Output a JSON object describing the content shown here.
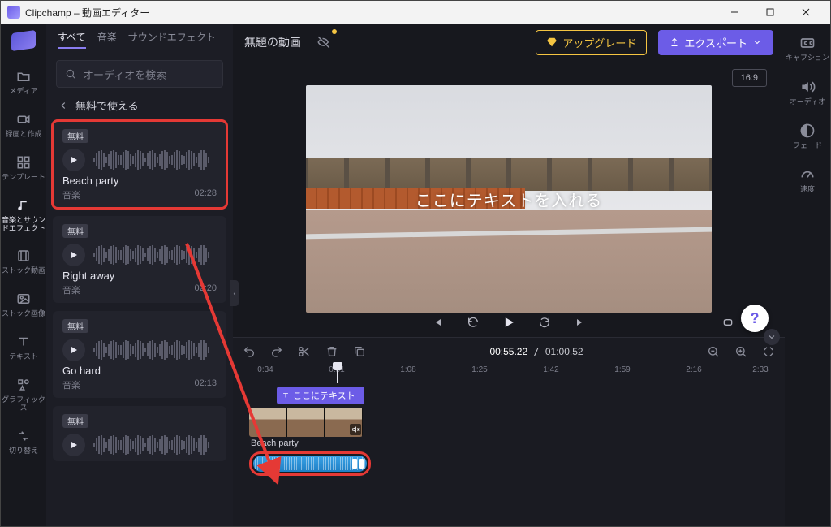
{
  "window": {
    "title": "Clipchamp – 動画エディター"
  },
  "rail": {
    "items": [
      {
        "label": "メディア"
      },
      {
        "label": "録画と作成"
      },
      {
        "label": "テンプレート"
      },
      {
        "label": "音楽とサウンドエフェクト"
      },
      {
        "label": "ストック動画"
      },
      {
        "label": "ストック画像"
      },
      {
        "label": "テキスト"
      },
      {
        "label": "グラフィックス"
      },
      {
        "label": "切り替え"
      }
    ]
  },
  "library": {
    "tabs": {
      "all": "すべて",
      "music": "音楽",
      "sfx": "サウンドエフェクト"
    },
    "search_placeholder": "オーディオを検索",
    "breadcrumb": "無料で使える",
    "free_badge": "無料",
    "category": "音楽",
    "tracks": [
      {
        "name": "Beach party",
        "duration": "02:28"
      },
      {
        "name": "Right away",
        "duration": "02:20"
      },
      {
        "name": "Go hard",
        "duration": "02:13"
      }
    ]
  },
  "project": {
    "title": "無題の動画"
  },
  "topbar": {
    "upgrade": "アップグレード",
    "export": "エクスポート"
  },
  "preview": {
    "aspect": "16:9",
    "overlay_text": "ここにテキストを入れる"
  },
  "player": {
    "skip_back": "5",
    "skip_fwd": "5"
  },
  "help": {
    "label": "?"
  },
  "prop_rail": {
    "items": [
      {
        "label": "キャプション"
      },
      {
        "label": "オーディオ"
      },
      {
        "label": "フェード"
      },
      {
        "label": "速度"
      }
    ]
  },
  "timeline": {
    "timecode_current": "00:55.22",
    "timecode_total": "01:00.52",
    "ruler": [
      "0:34",
      "0:51",
      "1:08",
      "1:25",
      "1:42",
      "1:59",
      "2:16",
      "2:33"
    ],
    "text_clip_label": "ここにテキスト",
    "audio_clip_label": "Beach party"
  }
}
